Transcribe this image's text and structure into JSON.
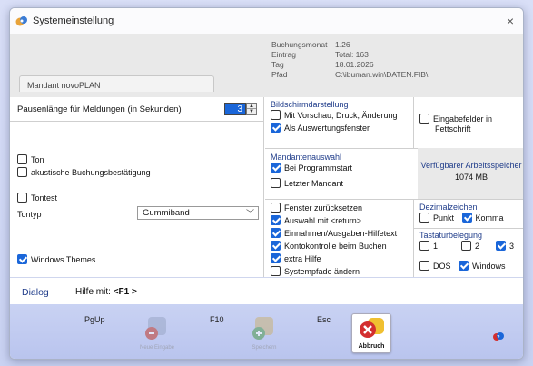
{
  "window": {
    "title": "Systemeinstellung",
    "close": "×"
  },
  "info": {
    "buchungsmonat_label": "Buchungsmonat",
    "buchungsmonat_value": "1.26",
    "eintrag_label": "Eintrag",
    "eintrag_value": "Total: 163",
    "tag_label": "Tag",
    "tag_value": "18.01.2026",
    "pfad_label": "Pfad",
    "pfad_value": "C:\\ibuman.win\\DATEN.FIB\\"
  },
  "tab": {
    "label": "Mandant  novoPLAN"
  },
  "left": {
    "pause_label": "Pausenlänge für Meldungen (in Sekunden)",
    "pause_value": "3",
    "ton": "Ton",
    "akustische": "akustische Buchungsbestätigung",
    "tontest": "Tontest",
    "tontyp_label": "Tontyp",
    "tontyp_value": "Gummiband",
    "windows_themes": "Windows Themes"
  },
  "bildschirm": {
    "title": "Bildschirmdarstellung",
    "vorschau": "Mit Vorschau, Druck, Änderung",
    "auswertung": "Als Auswertungsfenster",
    "eingabe_line1": "Eingabefelder in",
    "eingabe_line2": "Fettschrift"
  },
  "mandanten": {
    "title": "Mandantenauswahl",
    "programmstart": "Bei Programmstart",
    "letzter": "Letzter Mandant"
  },
  "speicher": {
    "title": "Verfügbarer Arbeitsspeicher",
    "value": "1074 MB"
  },
  "options": {
    "fenster": "Fenster zurücksetzen",
    "auswahl": "Auswahl mit <return>",
    "einnahmen": "Einnahmen/Ausgaben-Hilfetext",
    "kontokontrolle": "Kontokontrolle beim Buchen",
    "extra": "extra Hilfe",
    "systempfade": "Systempfade ändern"
  },
  "dezimal": {
    "title": "Dezimalzeichen",
    "punkt": "Punkt",
    "komma": "Komma"
  },
  "tastatur": {
    "title": "Tastaturbelegung",
    "t1": "1",
    "t2": "2",
    "t3": "3",
    "dos": "DOS",
    "windows": "Windows"
  },
  "status": {
    "dialog": "Dialog",
    "hilfe_prefix": "Hilfe mit:",
    "hilfe_key": "<F1 >"
  },
  "toolbar": {
    "key1": "PgUp",
    "btn1": "Neue Eingabe",
    "key2": "F10",
    "btn2": "Speichern",
    "key3": "Esc",
    "btn3": "Abbruch"
  }
}
